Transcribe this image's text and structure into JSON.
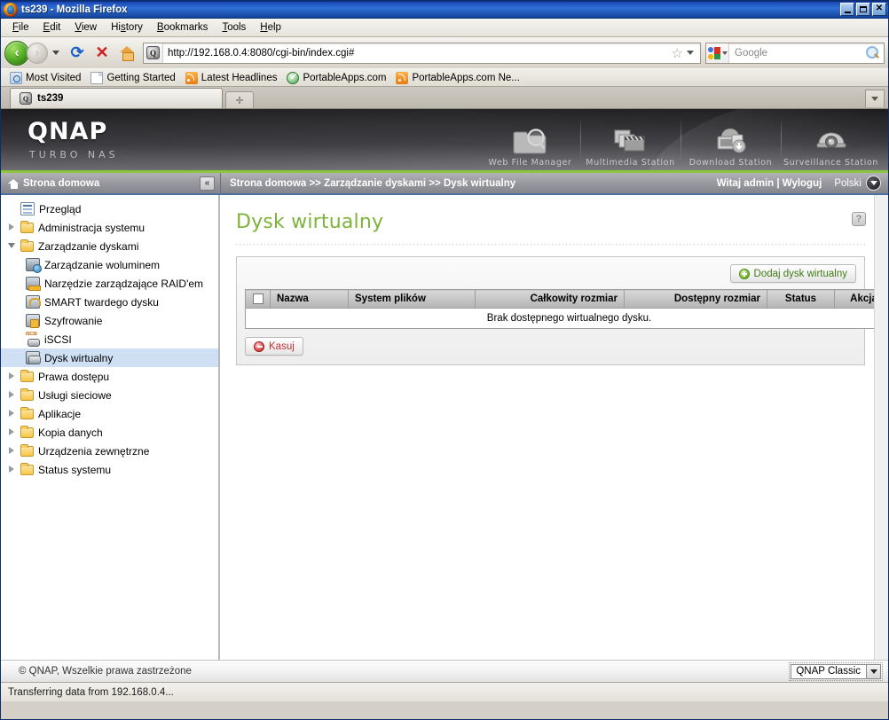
{
  "browser": {
    "window_title": "ts239 - Mozilla Firefox",
    "menus": [
      "File",
      "Edit",
      "View",
      "History",
      "Bookmarks",
      "Tools",
      "Help"
    ],
    "url": "http://192.168.0.4:8080/cgi-bin/index.cgi#",
    "search_placeholder": "Google",
    "bookmarks": [
      {
        "label": "Most Visited",
        "icon": "most-visited-icon"
      },
      {
        "label": "Getting Started",
        "icon": "document-icon"
      },
      {
        "label": "Latest Headlines",
        "icon": "rss-icon"
      },
      {
        "label": "PortableApps.com",
        "icon": "portableapps-icon"
      },
      {
        "label": "PortableApps.com Ne...",
        "icon": "rss-icon"
      }
    ],
    "tab_title": "ts239",
    "status_text": "Transferring data from 192.168.0.4...",
    "window_buttons": {
      "minimize": "_",
      "maximize": "❐",
      "close": "✕"
    }
  },
  "banner": {
    "logo": "QNAP",
    "tagline": "TURBO NAS",
    "apps": [
      {
        "label": "Web File Manager",
        "icon": "folder-search-icon"
      },
      {
        "label": "Multimedia Station",
        "icon": "photos-clapperboard-icon"
      },
      {
        "label": "Download Station",
        "icon": "download-monitor-icon"
      },
      {
        "label": "Surveillance Station",
        "icon": "dome-camera-icon"
      }
    ]
  },
  "sidebar": {
    "header": "Strona domowa",
    "collapse_label": "«",
    "items": [
      {
        "label": "Przegląd",
        "level": 1,
        "icon": "overview-icon",
        "twisty": "none",
        "selected": false
      },
      {
        "label": "Administracja systemu",
        "level": 1,
        "icon": "folder-icon",
        "twisty": "closed",
        "selected": false
      },
      {
        "label": "Zarządzanie dyskami",
        "level": 1,
        "icon": "folder-open-icon",
        "twisty": "open",
        "selected": false
      },
      {
        "label": "Zarządzanie woluminem",
        "level": 2,
        "icon": "volume-management-icon",
        "twisty": "none",
        "selected": false
      },
      {
        "label": "Narzędzie zarządzające RAID'em",
        "level": 2,
        "icon": "raid-tool-icon",
        "twisty": "none",
        "selected": false
      },
      {
        "label": "SMART twardego dysku",
        "level": 2,
        "icon": "smart-disk-icon",
        "twisty": "none",
        "selected": false
      },
      {
        "label": "Szyfrowanie",
        "level": 2,
        "icon": "encryption-lock-icon",
        "twisty": "none",
        "selected": false
      },
      {
        "label": "iSCSI",
        "level": 2,
        "icon": "iscsi-icon",
        "twisty": "none",
        "selected": false
      },
      {
        "label": "Dysk wirtualny",
        "level": 2,
        "icon": "virtual-disk-icon",
        "twisty": "none",
        "selected": true
      },
      {
        "label": "Prawa dostępu",
        "level": 1,
        "icon": "folder-icon",
        "twisty": "closed",
        "selected": false
      },
      {
        "label": "Usługi sieciowe",
        "level": 1,
        "icon": "folder-icon",
        "twisty": "closed",
        "selected": false
      },
      {
        "label": "Aplikacje",
        "level": 1,
        "icon": "folder-icon",
        "twisty": "closed",
        "selected": false
      },
      {
        "label": "Kopia danych",
        "level": 1,
        "icon": "folder-icon",
        "twisty": "closed",
        "selected": false
      },
      {
        "label": "Urządzenia zewnętrzne",
        "level": 1,
        "icon": "folder-icon",
        "twisty": "closed",
        "selected": false
      },
      {
        "label": "Status systemu",
        "level": 1,
        "icon": "folder-icon",
        "twisty": "closed",
        "selected": false
      }
    ]
  },
  "topbar": {
    "breadcrumb": "Strona domowa >> Zarządzanie dyskami >> Dysk wirtualny",
    "welcome": "Witaj admin",
    "separator": "|",
    "logout": "Wyloguj",
    "language": "Polski"
  },
  "main": {
    "title": "Dysk wirtualny",
    "help_label": "?",
    "add_button": "Dodaj dysk wirtualny",
    "delete_button": "Kasuj",
    "table": {
      "columns": [
        "Nazwa",
        "System plików",
        "Całkowity rozmiar",
        "Dostępny rozmiar",
        "Status",
        "Akcja"
      ],
      "rows": [],
      "empty_message": "Brak dostępnego wirtualnego dysku."
    }
  },
  "footer": {
    "copyright": "© QNAP, Wszelkie prawa zastrzeżone",
    "skin": "QNAP Classic"
  },
  "colors": {
    "accent_green": "#8cc63e",
    "title_green": "#7db33a",
    "titlebar_blue": "#1b4ab5",
    "selection_blue": "#cfe0f5"
  }
}
